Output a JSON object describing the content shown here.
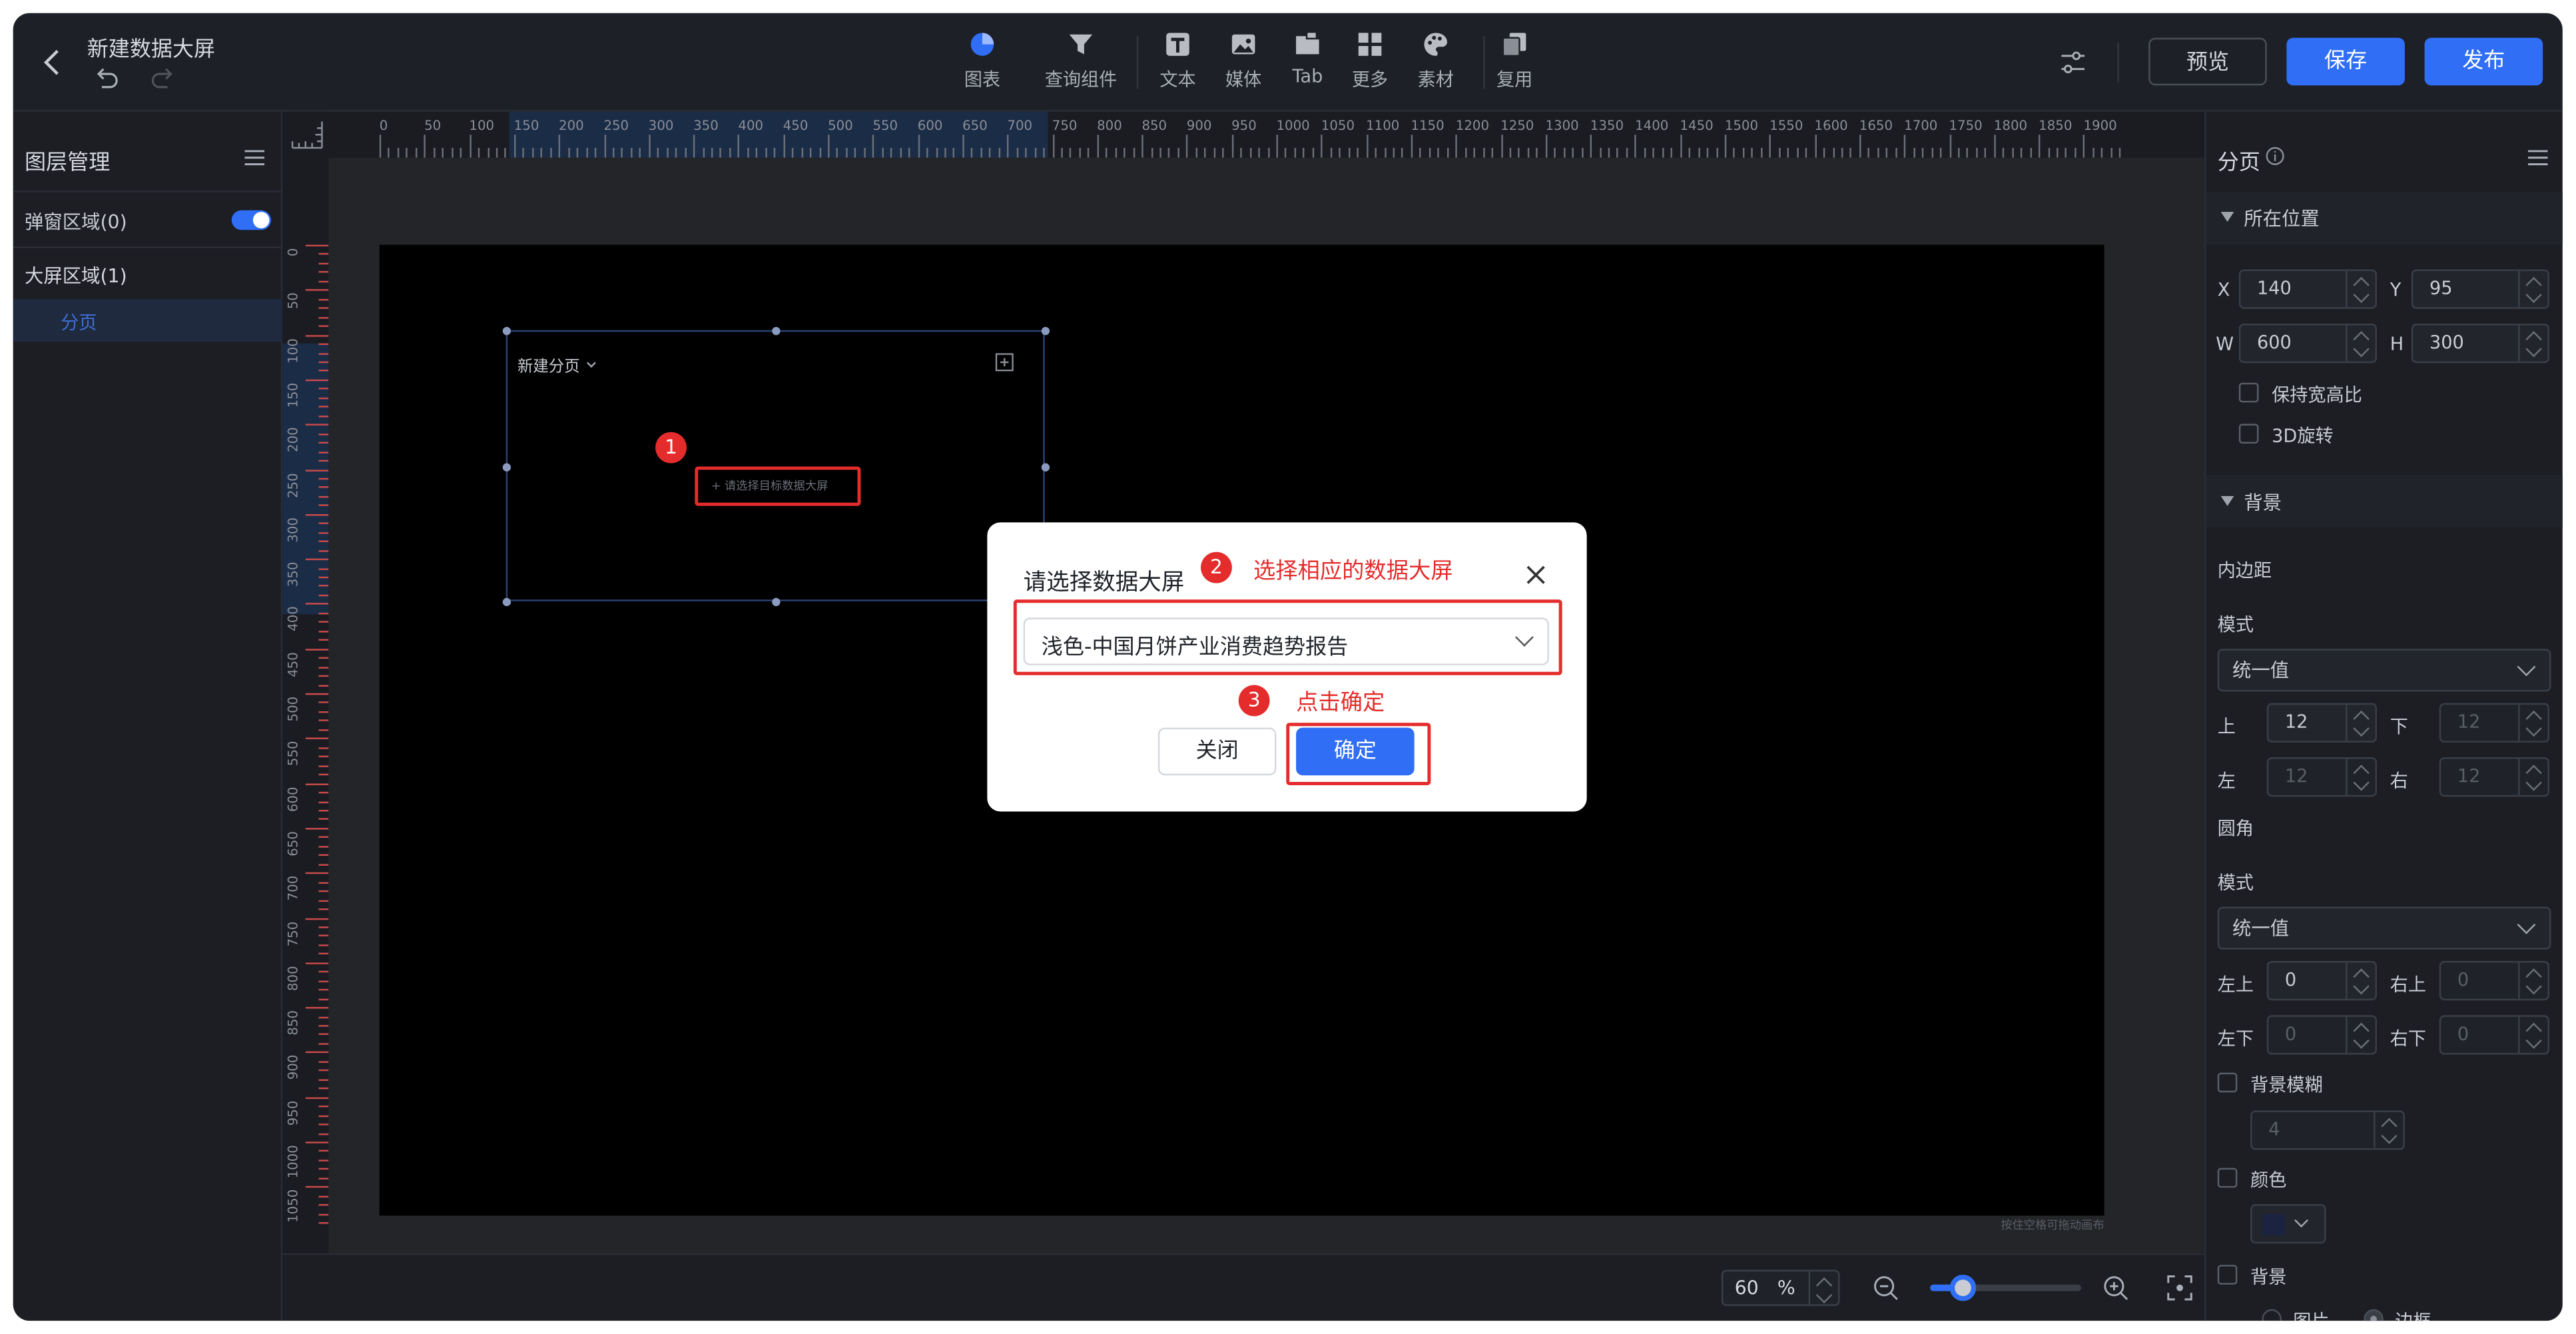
{
  "header": {
    "title": "新建数据大屏",
    "tools": [
      {
        "label": "图表",
        "icon": "pie-chart-icon"
      },
      {
        "label": "查询组件",
        "icon": "filter-icon"
      },
      {
        "label": "文本",
        "icon": "text-icon"
      },
      {
        "label": "媒体",
        "icon": "image-icon"
      },
      {
        "label": "Tab",
        "icon": "tab-icon"
      },
      {
        "label": "更多",
        "icon": "grid-icon"
      },
      {
        "label": "素材",
        "icon": "palette-icon"
      },
      {
        "label": "复用",
        "icon": "copy-icon"
      }
    ],
    "preview_label": "预览",
    "save_label": "保存",
    "publish_label": "发布"
  },
  "layers": {
    "title": "图层管理",
    "popup_area": "弹窗区域(0)",
    "screen_area": "大屏区域(1)",
    "page_item": "分页"
  },
  "ruler": {
    "top_ticks": [
      "0",
      "50",
      "100",
      "150",
      "200",
      "250",
      "300",
      "350",
      "400",
      "450",
      "500",
      "550",
      "600",
      "650",
      "700",
      "750",
      "800",
      "850",
      "900",
      "950",
      "1000",
      "1050",
      "1100",
      "1150",
      "1200",
      "1250",
      "1300",
      "1350",
      "1400",
      "1450",
      "1500",
      "1550",
      "1600",
      "1650",
      "1700",
      "1750",
      "1800",
      "1850",
      "1900"
    ],
    "left_ticks": [
      "0",
      "50",
      "100",
      "150",
      "200",
      "250",
      "300",
      "350",
      "400",
      "450",
      "500",
      "550",
      "600",
      "650",
      "700",
      "750",
      "800",
      "850",
      "900",
      "950",
      "1000",
      "1050"
    ]
  },
  "canvas": {
    "widget_title": "新建分页",
    "placeholder": "请选择目标数据大屏",
    "hint": "按住空格可拖动画布"
  },
  "modal": {
    "title": "请选择数据大屏",
    "selected": "浅色-中国月饼产业消费趋势报告",
    "close_label": "关闭",
    "confirm_label": "确定"
  },
  "annotations": {
    "step1": "1",
    "step2": "2",
    "step2_text": "选择相应的数据大屏",
    "step3": "3",
    "step3_text": "点击确定"
  },
  "properties": {
    "title": "分页",
    "position_section": "所在位置",
    "x_label": "X",
    "x_value": "140",
    "y_label": "Y",
    "y_value": "95",
    "w_label": "W",
    "w_value": "600",
    "h_label": "H",
    "h_value": "300",
    "keep_ratio": "保持宽高比",
    "rotate3d": "3D旋转",
    "bg_section": "背景",
    "padding_label": "内边距",
    "mode_label": "模式",
    "mode_value": "统一值",
    "top_label": "上",
    "top_value": "12",
    "bottom_label": "下",
    "bottom_value": "12",
    "left_label": "左",
    "left_value": "12",
    "right_label": "右",
    "right_value": "12",
    "radius_label": "圆角",
    "mode2_label": "模式",
    "mode2_value": "统一值",
    "tl_label": "左上",
    "tl_value": "0",
    "tr_label": "右上",
    "tr_value": "0",
    "bl_label": "左下",
    "bl_value": "0",
    "br_label": "右下",
    "br_value": "0",
    "blur_label": "背景模糊",
    "blur_value": "4",
    "color_label": "颜色",
    "bg_label": "背景",
    "image_label": "图片",
    "border_label": "边框"
  },
  "footer": {
    "zoom_value": "60",
    "zoom_unit": "%",
    "zoom_fraction": 0.22
  },
  "colors": {
    "accent": "#2f6ef5",
    "annotation": "#e52c2c",
    "canvas": "#000000"
  }
}
